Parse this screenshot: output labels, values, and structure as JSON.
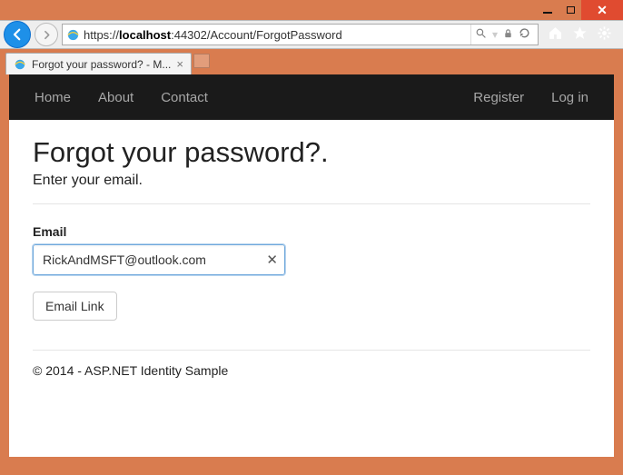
{
  "window": {
    "url_proto": "https://",
    "url_host": "localhost",
    "url_path": ":44302/Account/ForgotPassword"
  },
  "tab": {
    "title": "Forgot your password? - M..."
  },
  "nav": {
    "home": "Home",
    "about": "About",
    "contact": "Contact",
    "register": "Register",
    "login": "Log in"
  },
  "page": {
    "heading": "Forgot your password?.",
    "subheading": "Enter your email.",
    "email_label": "Email",
    "email_value": "RickAndMSFT@outlook.com",
    "submit_label": "Email Link",
    "footer_text": "© 2014 - ASP.NET Identity Sample"
  }
}
